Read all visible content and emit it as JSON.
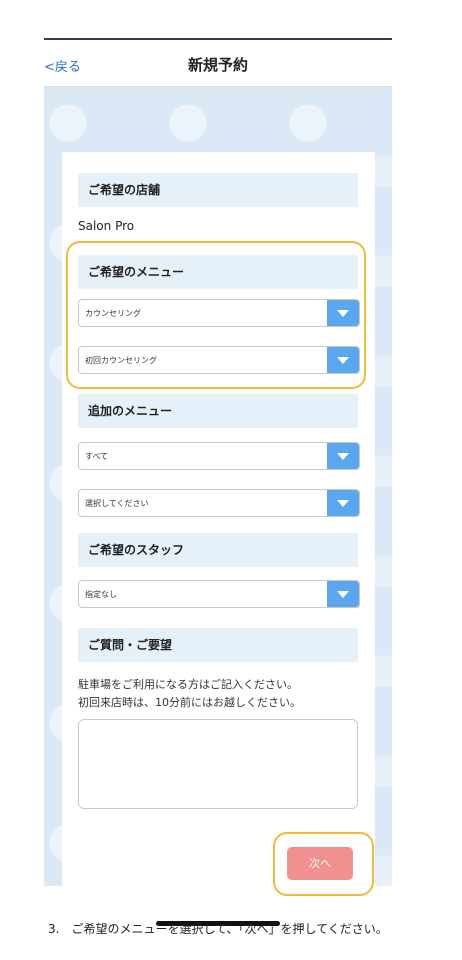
{
  "nav": {
    "back_label": "<戻る",
    "title": "新規予約"
  },
  "sections": {
    "store": {
      "header": "ご希望の店舗",
      "value": "Salon Pro"
    },
    "menu": {
      "header": "ご希望のメニュー",
      "select1": "カウンセリング",
      "select2": "初回カウンセリング"
    },
    "additional": {
      "header": "追加のメニュー",
      "select1": "すべて",
      "select2": "選択してください"
    },
    "staff": {
      "header": "ご希望のスタッフ",
      "select": "指定なし"
    },
    "questions": {
      "header": "ご質問・ご要望",
      "note_line1": "駐車場をご利用になる方はご記入ください。",
      "note_line2": "初回来店時は、10分前にはお越しください。",
      "textarea_value": ""
    }
  },
  "buttons": {
    "next_label": "次へ"
  },
  "caption": "3.　ご希望のメニューを選択して、「次へ」を押してください。",
  "colors": {
    "accent_blue": "#5aa7f0",
    "highlight": "#f0bb3a",
    "next_button": "#f09090",
    "section_bg": "#e6f0f9"
  }
}
